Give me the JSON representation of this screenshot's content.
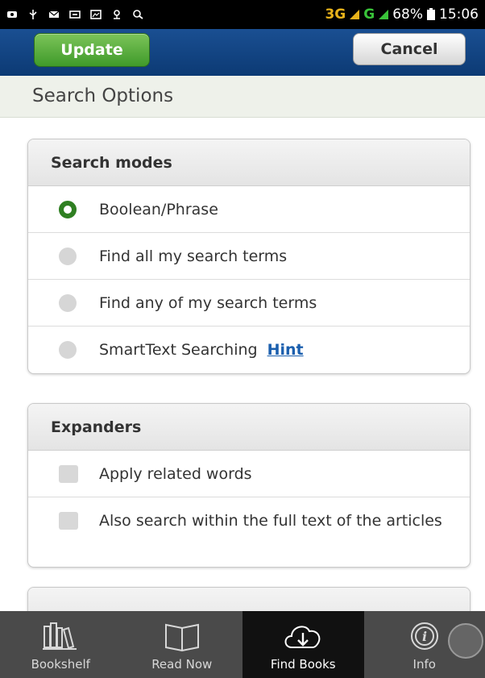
{
  "status_bar": {
    "network_1": "3G",
    "network_2": "G",
    "battery": "68%",
    "time": "15:06",
    "icons": [
      "notification-icon",
      "usb-icon",
      "mail-icon",
      "message-icon",
      "gallery-icon",
      "location-icon",
      "search-icon"
    ]
  },
  "action_bar": {
    "update_label": "Update",
    "cancel_label": "Cancel"
  },
  "page_title": "Search Options",
  "search_modes": {
    "header": "Search modes",
    "options": [
      {
        "label": "Boolean/Phrase",
        "selected": true
      },
      {
        "label": "Find all my search terms",
        "selected": false
      },
      {
        "label": "Find any of my search terms",
        "selected": false
      },
      {
        "label": "SmartText Searching",
        "selected": false,
        "hint": "Hint"
      }
    ]
  },
  "expanders": {
    "header": "Expanders",
    "options": [
      {
        "label": "Apply related words",
        "checked": false
      },
      {
        "label": "Also search within the full text of the articles",
        "checked": false
      }
    ]
  },
  "bottom_nav": {
    "items": [
      {
        "label": "Bookshelf",
        "icon": "bookshelf-icon",
        "active": false
      },
      {
        "label": "Read Now",
        "icon": "open-book-icon",
        "active": false
      },
      {
        "label": "Find Books",
        "icon": "cloud-download-icon",
        "active": true
      },
      {
        "label": "Info",
        "icon": "info-icon",
        "active": false
      }
    ]
  },
  "colors": {
    "action_bar": "#1a4f92",
    "update_button": "#4fa834",
    "selected_radio": "#2f7f22",
    "hint_link": "#1b5fae",
    "bottom_nav": "#4a4a4a"
  }
}
